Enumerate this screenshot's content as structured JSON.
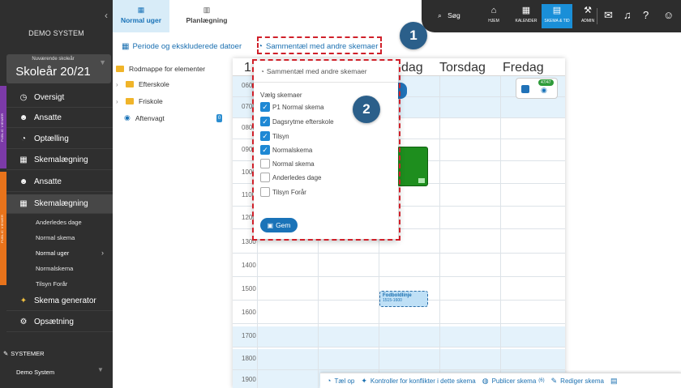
{
  "sidebar": {
    "system_title": "DEMO SYSTEM",
    "year_label": "Nuværende skoleår",
    "year_value": "Skoleår 20/21",
    "tag_top": "PUBLIC VIEWER",
    "tag_bottom": "PUBLIC VIEWER",
    "items": [
      {
        "label": "Oversigt",
        "icon": "dashboard-icon"
      },
      {
        "label": "Ansatte",
        "icon": "employees-icon"
      },
      {
        "label": "Optælling",
        "icon": "clock-icon"
      },
      {
        "label": "Skemalægning",
        "icon": "calendar-icon"
      },
      {
        "label": "Ansatte",
        "icon": "employees-icon"
      },
      {
        "label": "Skemalægning",
        "icon": "calendar-icon"
      }
    ],
    "sub_items": [
      "Anderledes dage",
      "Normal skema",
      "Normal uger",
      "Normalskema",
      "Tilsyn Forår"
    ],
    "bottom_items": [
      {
        "label": "Skema generator",
        "icon": "wand-icon"
      },
      {
        "label": "Opsætning",
        "icon": "gear-icon"
      }
    ],
    "systemer_label": "SYSTEMER",
    "demo_label": "Demo System"
  },
  "tabs": [
    {
      "label": "Normal uger",
      "icon": "calendar-icon"
    },
    {
      "label": "Planlægning",
      "icon": "grid-icon"
    }
  ],
  "topnav": {
    "search_label": "Søg",
    "items": [
      "HJEM",
      "KALENDER",
      "SKEMA & TID",
      "ADMIN"
    ]
  },
  "toolbar": {
    "periode_label": "Periode og ekskluderede datoer",
    "sammen_label": "Sammentæl med andre skemaer"
  },
  "tree": {
    "items": [
      "Rodmappe for elementer",
      "Efterskole",
      "Friskole",
      "Aftenvagt"
    ],
    "badge": "0"
  },
  "calendar": {
    "days": [
      "1",
      "dag",
      "Torsdag",
      "Fredag"
    ],
    "hours": [
      "0600",
      "0700",
      "0800",
      "0900",
      "1000",
      "1100",
      "1200",
      "1300",
      "1400",
      "1500",
      "1600",
      "1700",
      "1800",
      "1900"
    ],
    "event_title": "Fodboldlinje",
    "event_time": "1515-1600",
    "widget_count": "47/47"
  },
  "popup": {
    "title": "Sammentæl med andre skemaer",
    "section_label": "Vælg skemaer",
    "options": [
      {
        "label": "P1 Normal skema",
        "checked": true
      },
      {
        "label": "Dagsrytme efterskole",
        "checked": true
      },
      {
        "label": "Tilsyn",
        "checked": true
      },
      {
        "label": "Normalskema",
        "checked": true
      },
      {
        "label": "Normal skema",
        "checked": false
      },
      {
        "label": "Anderledes dage",
        "checked": false
      },
      {
        "label": "Tilsyn Forår",
        "checked": false
      }
    ],
    "save_label": "Gem"
  },
  "callouts": [
    "1",
    "2"
  ],
  "bottombar": {
    "count_label": "Tæl op",
    "conflict_label": "Kontroller for konflikter i dette skema",
    "publish_label": "Publicer skema",
    "publish_count": "(6)",
    "edit_label": "Rediger skema"
  },
  "colors": {
    "accent": "#1a73b8",
    "sidebar_bg": "#2f2f2f",
    "highlight": "#d0202a",
    "callout": "#2b5f8a"
  }
}
